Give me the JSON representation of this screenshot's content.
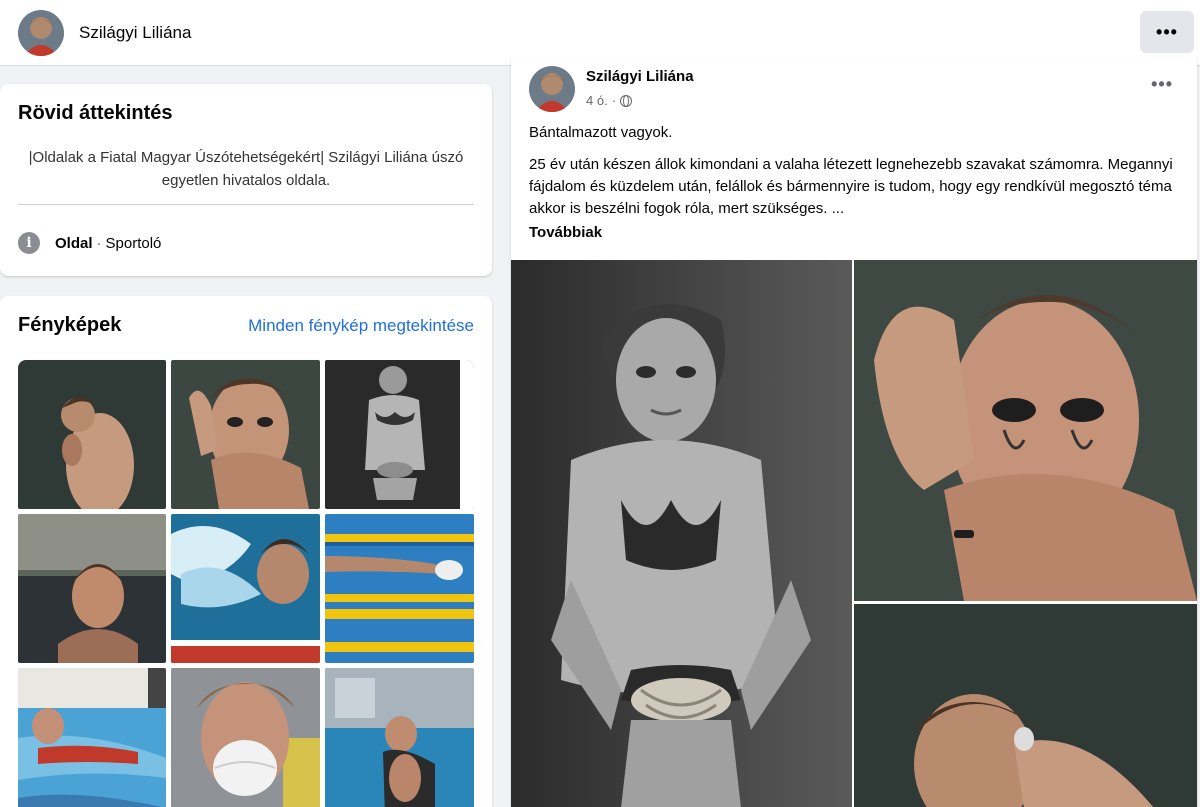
{
  "header": {
    "page_name": "Szilágyi Liliána",
    "more_label": "•••"
  },
  "intro": {
    "title": "Rövid áttekintés",
    "description": "|Oldalak a Fiatal Magyar Úszótehetségekért| Szilágyi Liliána úszó egyetlen hivatalos oldala.",
    "info_icon_glyph": "i",
    "page_type": "Oldal",
    "separator": "·",
    "category": "Sportoló"
  },
  "photos": {
    "title": "Fényképek",
    "see_all": "Minden fénykép megtekintése",
    "items": [
      {
        "name": "photo-1",
        "alt": "Woman turned away, bare back, dark background"
      },
      {
        "name": "photo-2",
        "alt": "Woman covering her mouth with a hand"
      },
      {
        "name": "photo-3",
        "alt": "Black-and-white photo, hands tied with rope"
      },
      {
        "name": "photo-4",
        "alt": "Woman in water at sunset"
      },
      {
        "name": "photo-5",
        "alt": "Swimmer splashing in pool"
      },
      {
        "name": "photo-6",
        "alt": "Swimmer in a lane with getty images watermark"
      },
      {
        "name": "photo-7",
        "alt": "Painting of swimmer"
      },
      {
        "name": "photo-8",
        "alt": "Woman wearing a white face mask"
      },
      {
        "name": "photo-9",
        "alt": "Woman sitting by indoor pool"
      }
    ]
  },
  "post": {
    "author": "Szilágyi Liliána",
    "time": "4 ó.",
    "time_sep": "·",
    "options_label": "•••",
    "first_line": "Bántalmazott vagyok.",
    "body": "25 év után készen állok kimondani a valaha létezett legnehezebb szavakat számomra. Megannyi fájdalom és küzdelem után, felállok és bármennyire is tudom, hogy egy rendkívül megosztó téma akkor is beszélni fogok róla, mert szükséges. ...",
    "see_more": "Továbbiak"
  },
  "colors": {
    "link": "#216fdb",
    "background": "#f0f2f5",
    "secondary_text": "#65676b"
  }
}
